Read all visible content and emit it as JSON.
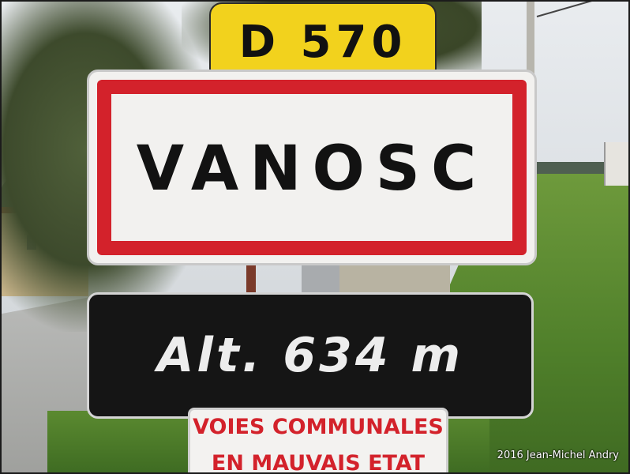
{
  "photo": {
    "route_sign": {
      "text": "D 570",
      "color": "#f2d21d"
    },
    "town_sign": {
      "text": "VANOSC",
      "border_color": "#d3222b"
    },
    "altitude_sign": {
      "text": "Alt. 634 m"
    },
    "warning_sign": {
      "line1": "VOIES COMMUNALES",
      "line2": "EN MAUVAIS ETAT",
      "color": "#d3222b"
    },
    "credit": "2016 Jean-Michel Andry"
  }
}
